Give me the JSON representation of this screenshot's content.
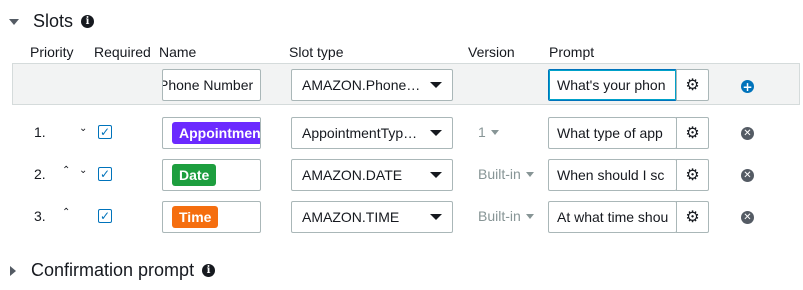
{
  "slots_section": {
    "title": "Slots",
    "info_icon": "info-icon"
  },
  "columns": {
    "priority": "Priority",
    "required": "Required",
    "name": "Name",
    "slot_type": "Slot type",
    "version": "Version",
    "prompt": "Prompt"
  },
  "new_slot": {
    "name": "Phone Number",
    "slot_type": "AMAZON.Phone…",
    "prompt": "What's your phon",
    "add_icon": "add-icon"
  },
  "slots": [
    {
      "priority": "1.",
      "up": "",
      "down": "⌄",
      "required": true,
      "name": "AppointmentT",
      "color": "#6b2aff",
      "slot_type": "AppointmentTyp…",
      "version": "1",
      "prompt": "What type of app"
    },
    {
      "priority": "2.",
      "up": "⌃",
      "down": "⌄",
      "required": true,
      "name": "Date",
      "color": "#1d9e3e",
      "slot_type": "AMAZON.DATE",
      "version": "Built-in",
      "prompt": "When should I sc"
    },
    {
      "priority": "3.",
      "up": "⌃",
      "down": "",
      "required": true,
      "name": "Time",
      "color": "#f56e0f",
      "slot_type": "AMAZON.TIME",
      "version": "Built-in",
      "prompt": "At what time shou"
    }
  ],
  "confirmation_section": {
    "title": "Confirmation prompt",
    "info_icon": "info-icon"
  },
  "colors": {
    "accent": "#0073bb",
    "border": "#aab7b8",
    "row_bg": "#f2f3f3"
  }
}
